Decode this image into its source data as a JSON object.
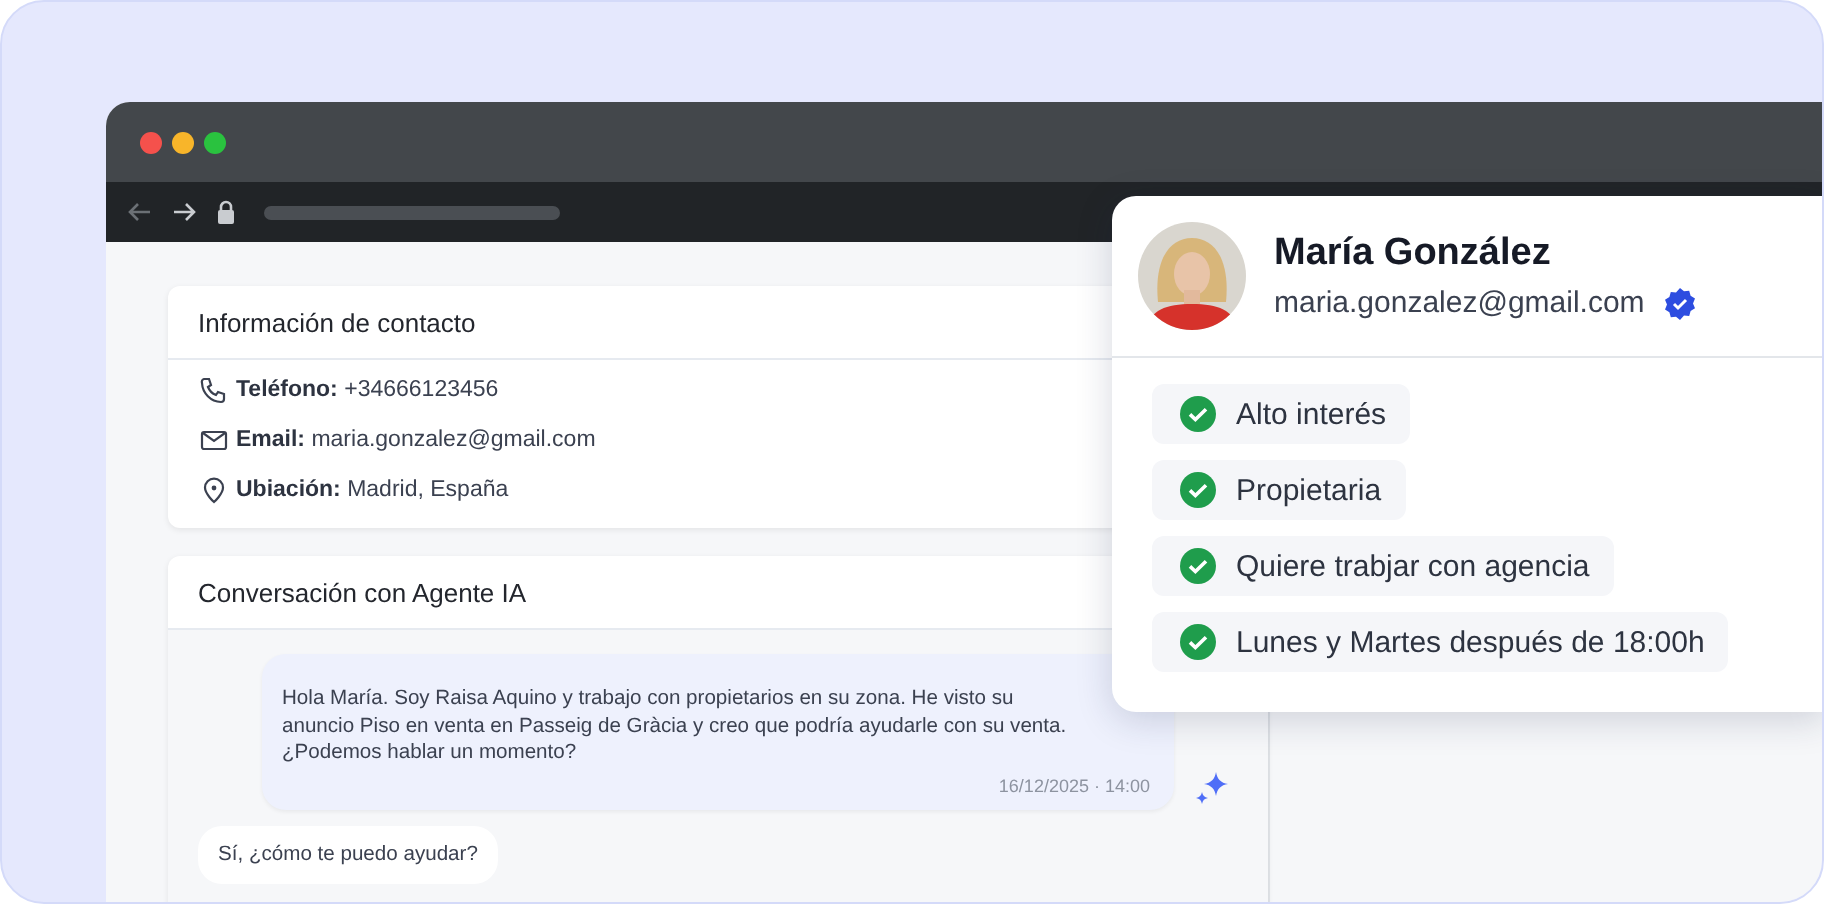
{
  "contact_card": {
    "title": "Información de contacto",
    "rows": [
      {
        "kind": "phone",
        "label": "Teléfono:",
        "value": "+34666123456"
      },
      {
        "kind": "email",
        "label": "Email:",
        "value": "maria.gonzalez@gmail.com"
      },
      {
        "kind": "location",
        "label": "Ubiación:",
        "value": "Madrid, España"
      }
    ]
  },
  "conversation": {
    "title": "Conversación con Agente IA",
    "messages": [
      {
        "kind": "agent",
        "text": "Hola María. Soy Raisa Aquino y trabajo con propietarios en su zona. He visto su anuncio Piso en venta en Passeig de Gràcia y creo que podría ayudarle con su venta. ¿Podemos hablar un momento?",
        "time": "16/12/2025 · 14:00"
      },
      {
        "kind": "lead",
        "text": "Sí, ¿cómo te puedo ayudar?"
      }
    ]
  },
  "profile": {
    "name": "María González",
    "email": "maria.gonzalez@gmail.com",
    "verified": true,
    "tags": [
      {
        "label": "Alto interés",
        "checked": true
      },
      {
        "label": "Propietaria",
        "checked": true
      },
      {
        "label": "Quiere trabjar con agencia",
        "checked": true
      },
      {
        "label": "Lunes y Martes después de 18:00h",
        "checked": true
      }
    ]
  }
}
